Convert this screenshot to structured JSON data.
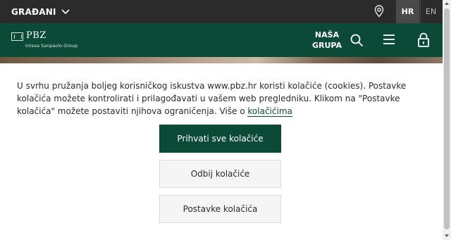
{
  "topbar": {
    "segment_label": "GRAĐANI",
    "languages": {
      "active": "HR",
      "other": "EN"
    }
  },
  "navbar": {
    "logo_name": "PBZ",
    "logo_subtitle": "Intesa Sanpaolo Group",
    "group_line1": "NAŠA",
    "group_line2": "GRUPA"
  },
  "cookie_banner": {
    "text": "U svrhu pružanja boljeg korisničkog iskustva www.pbz.hr koristi kolačiće (cookies). Postavke kolačića možete kontrolirati i prilagođavati u vašem web pregledniku. Klikom na \"Postavke kolačića\" možete postaviti njihova ograničenja. Više o ",
    "link_label": "kolačićima",
    "accept_label": "Prihvati sve kolačiće",
    "reject_label": "Odbij kolačiće",
    "settings_label": "Postavke kolačića"
  },
  "colors": {
    "brand_green": "#0b4a37",
    "topbar_dark": "#2b2b2b"
  },
  "icons": [
    "chevron-down-icon",
    "location-pin-icon",
    "search-icon",
    "hamburger-menu-icon",
    "lock-icon",
    "pbz-logo-icon"
  ]
}
